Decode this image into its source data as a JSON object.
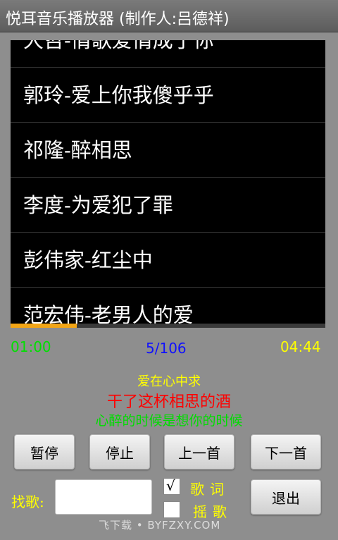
{
  "titlebar": {
    "title": "悦耳音乐播放器 (制作人:吕德祥)"
  },
  "playlist": {
    "items": [
      {
        "label": "大哲-情歌爱情成了你"
      },
      {
        "label": "郭玲-爱上你我傻乎乎"
      },
      {
        "label": "祁隆-醉相思"
      },
      {
        "label": "李度-为爱犯了罪"
      },
      {
        "label": "彭伟家-红尘中"
      },
      {
        "label": "范宏伟-老男人的爱"
      }
    ]
  },
  "playback": {
    "progress_fraction": 0.21,
    "current_time": "01:00",
    "track_counter": "5/106",
    "total_time": "04:44"
  },
  "lyrics": {
    "line1": "爱在心中求",
    "line2": "干了这杯相思的酒",
    "line3": "心醉的时候是想你的时候"
  },
  "controls": {
    "pause_label": "暂停",
    "stop_label": "停止",
    "prev_label": "上一首",
    "next_label": "下一首",
    "exit_label": "退出"
  },
  "search": {
    "label": "找歌:",
    "value": ""
  },
  "options": {
    "lyrics_label": "歌词",
    "lyrics_checked": true,
    "lyrics_check_glyph": "√",
    "shake_label": "摇歌",
    "shake_checked": false
  },
  "watermark": "飞下载 • BYFZXY.COM",
  "colors": {
    "progress": "#f2a516",
    "current_time": "#00e000",
    "counter": "#1010ff",
    "total_time": "#ffff00"
  }
}
